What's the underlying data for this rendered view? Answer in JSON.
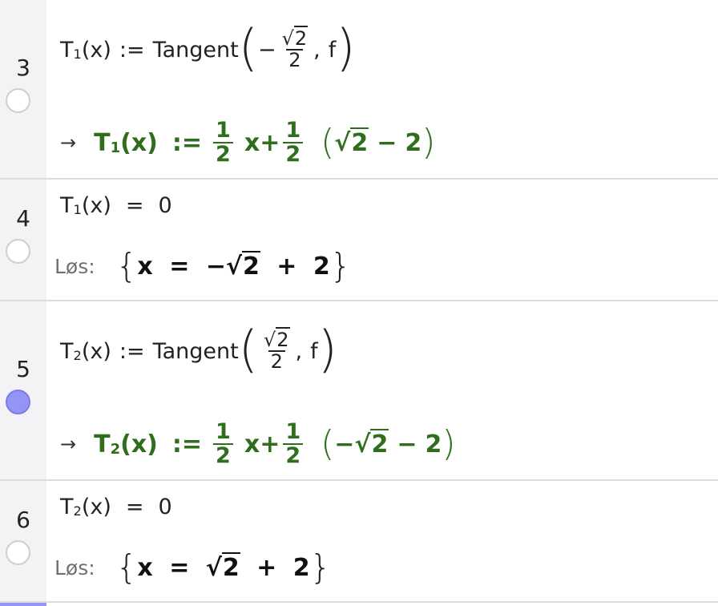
{
  "rows": [
    {
      "number": "3",
      "selected": false,
      "input": {
        "name": "T",
        "sub": "1",
        "arg": "(x)",
        "assign": ":=",
        "command": "Tangent",
        "minus": "−",
        "frac_num": "2",
        "frac_den": "2",
        "sep": ",",
        "func": "f"
      },
      "output": {
        "arrow": "→",
        "name": "T",
        "sub": "1",
        "arg": "(x)",
        "assign": ":=",
        "f1_num": "1",
        "f1_den": "2",
        "var": "x",
        "plus": "+",
        "f2_num": "1",
        "f2_den": "2",
        "paren_open": "(",
        "term_sign": "",
        "sqrt_arg": "2",
        "minus": "−",
        "const": "2",
        "paren_close": ")"
      }
    },
    {
      "number": "4",
      "selected": false,
      "input": {
        "name": "T",
        "sub": "1",
        "arg": "(x)",
        "eq": "=",
        "rhs": "0"
      },
      "solve": {
        "label": "Løs:",
        "brace_open": "{",
        "var": "x",
        "eq": "=",
        "sign": "−",
        "sqrt_arg": "2",
        "plus": "+",
        "const": "2",
        "brace_close": "}"
      }
    },
    {
      "number": "5",
      "selected": true,
      "input": {
        "name": "T",
        "sub": "2",
        "arg": "(x)",
        "assign": ":=",
        "command": "Tangent",
        "minus": "",
        "frac_num": "2",
        "frac_den": "2",
        "sep": ",",
        "func": "f"
      },
      "output": {
        "arrow": "→",
        "name": "T",
        "sub": "2",
        "arg": "(x)",
        "assign": ":=",
        "f1_num": "1",
        "f1_den": "2",
        "var": "x",
        "plus": "+",
        "f2_num": "1",
        "f2_den": "2",
        "paren_open": "(",
        "term_sign": "−",
        "sqrt_arg": "2",
        "minus": "−",
        "const": "2",
        "paren_close": ")"
      }
    },
    {
      "number": "6",
      "selected": false,
      "input": {
        "name": "T",
        "sub": "2",
        "arg": "(x)",
        "eq": "=",
        "rhs": "0"
      },
      "solve": {
        "label": "Løs:",
        "brace_open": "{",
        "var": "x",
        "eq": "=",
        "sign": "",
        "sqrt_arg": "2",
        "plus": "+",
        "const": "2",
        "brace_close": "}"
      }
    }
  ],
  "colors": {
    "output_green": "#2e6e1c",
    "selected_radio": "#9494f5",
    "gutter": "#f3f3f5"
  }
}
